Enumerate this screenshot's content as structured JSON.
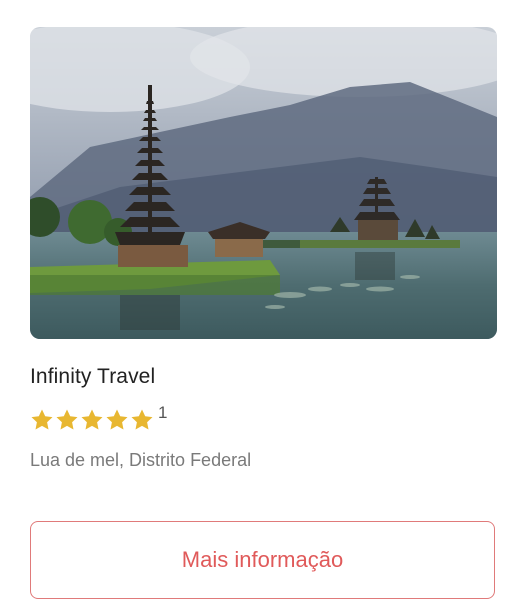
{
  "card": {
    "image_alt": "Temple on a lake with mountains",
    "title": "Infinity Travel",
    "rating": {
      "stars": 5,
      "max_stars": 5,
      "count": "1"
    },
    "subtitle": "Lua de mel, Distrito Federal",
    "button_label": "Mais informação"
  },
  "colors": {
    "star": "#e8b731",
    "button_border": "#e07a7a",
    "button_text": "#e05a5a",
    "title": "#222222",
    "subtitle": "#7a7a7a"
  }
}
